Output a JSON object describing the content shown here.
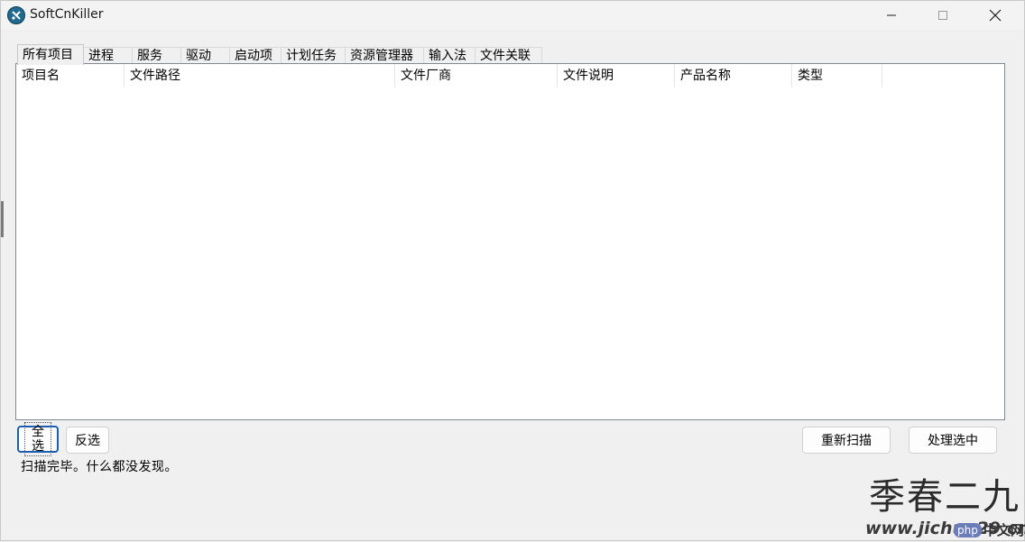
{
  "window": {
    "title": "SoftCnKiller",
    "controls": {
      "minimize": "─",
      "maximize": "☐",
      "close": "✕"
    }
  },
  "tabs": [
    {
      "label": "所有项目",
      "active": true
    },
    {
      "label": "进程",
      "active": false
    },
    {
      "label": "服务",
      "active": false
    },
    {
      "label": "驱动",
      "active": false
    },
    {
      "label": "启动项",
      "active": false
    },
    {
      "label": "计划任务",
      "active": false
    },
    {
      "label": "资源管理器",
      "active": false
    },
    {
      "label": "输入法",
      "active": false
    },
    {
      "label": "文件关联",
      "active": false
    }
  ],
  "table": {
    "columns": [
      "项目名",
      "文件路径",
      "文件厂商",
      "文件说明",
      "产品名称",
      "类型"
    ],
    "rows": []
  },
  "buttons": {
    "select_all": "全选",
    "invert": "反选",
    "rescan": "重新扫描",
    "process_selected": "处理选中"
  },
  "status": "扫描完毕。什么都没发现。",
  "watermark": {
    "text": "季春二九",
    "url": "www.jichun29.cn",
    "logo_php": "php",
    "logo_cn": "中文网"
  },
  "colors": {
    "focus_border": "#1a5fb4",
    "app_icon": "#1f6a8d",
    "php_badge": "#6b7db8"
  }
}
